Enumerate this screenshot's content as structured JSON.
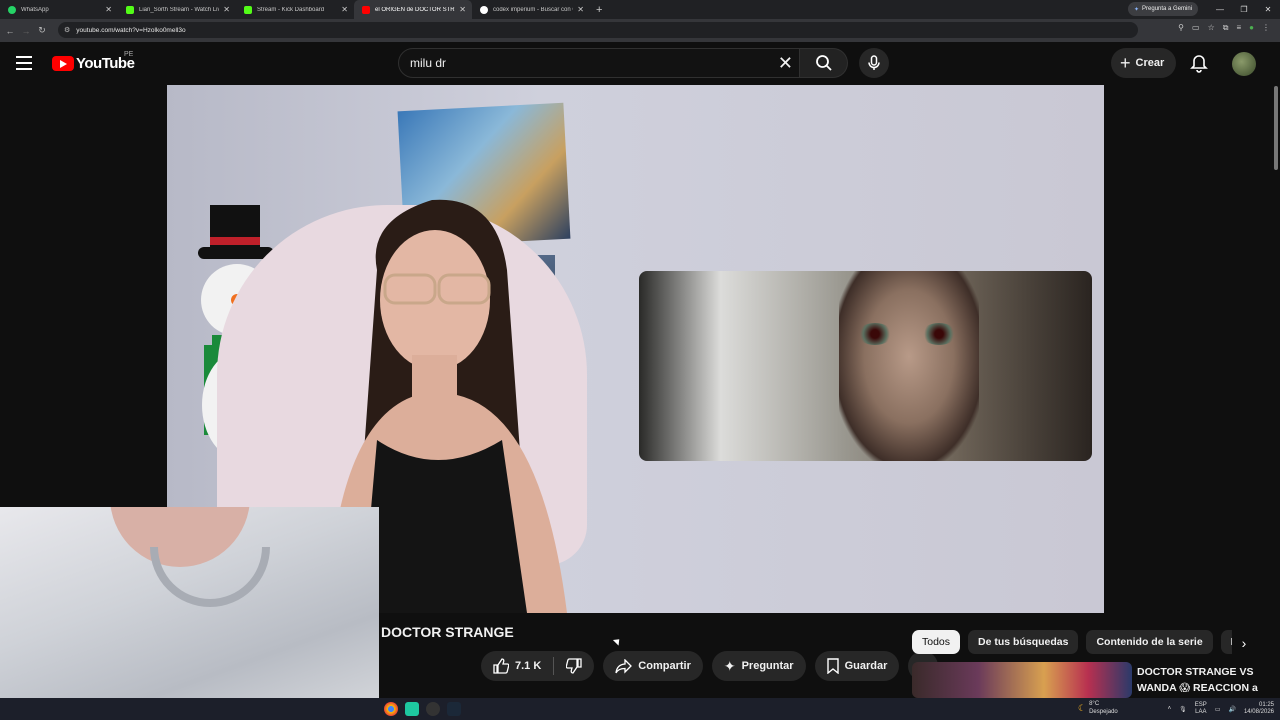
{
  "browser": {
    "tabs": [
      {
        "title": "WhatsApp",
        "color": "#25d366",
        "active": false
      },
      {
        "title": "Lian_Sorth Stream - Watch Live",
        "color": "#53fc18",
        "active": false
      },
      {
        "title": "Stream - Kick Dashboard",
        "color": "#53fc18",
        "active": false
      },
      {
        "title": "el ORIGEN de DOCTOR STR",
        "color": "#ff0000",
        "active": true
      },
      {
        "title": "codex imperium - Buscar con G",
        "color": "#4285f4",
        "active": false
      }
    ],
    "new_tab": "+",
    "gemini_button": "Pregunta a Gemini",
    "url": "youtube.com/watch?v=Hzolko0mell3o"
  },
  "youtube": {
    "logo_text": "YouTube",
    "country_code": "PE",
    "search_query": "milu dr",
    "create_label": "Crear"
  },
  "video": {
    "title": "DOCTOR STRANGE",
    "likes": "7.1 K",
    "share_label": "Compartir",
    "ask_label": "Preguntar",
    "save_label": "Guardar"
  },
  "sidebar": {
    "chips": [
      "Todos",
      "De tus búsquedas",
      "Contenido de la serie",
      "De"
    ],
    "recommendation_title": "DOCTOR STRANGE VS WANDA 😱 REACCION a DOCTOR STRANGE..."
  },
  "taskbar": {
    "temperature": "8°C",
    "weather": "Despejado",
    "lang": "ESP",
    "lang_sub": "LAA",
    "time": "01:25",
    "date": "14/08/2026"
  }
}
